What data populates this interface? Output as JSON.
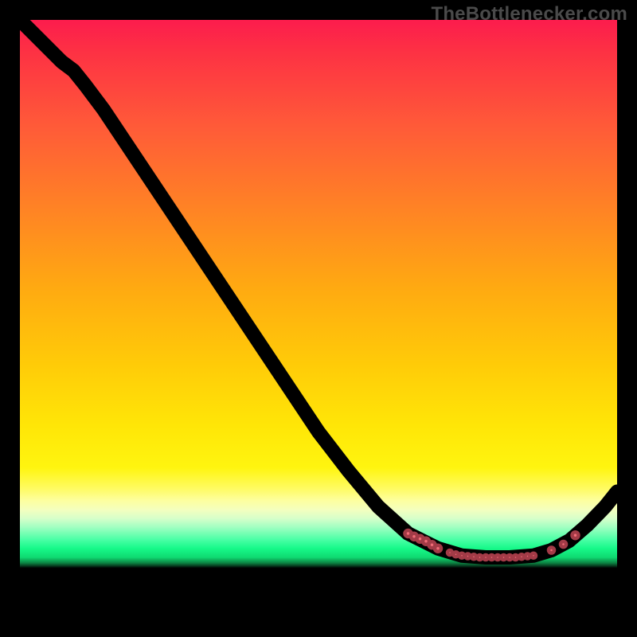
{
  "watermark": {
    "text": "TheBottlenecker.com"
  },
  "colors": {
    "background": "#000000",
    "gradient_top": "#fc1c4d",
    "gradient_mid": "#ffe607",
    "gradient_green": "#17f989",
    "curve": "#000000",
    "marker_fill": "#f26d78",
    "marker_stroke": "#a33b47"
  },
  "chart_data": {
    "type": "line",
    "title": "",
    "xlabel": "",
    "ylabel": "",
    "xlim": [
      0,
      100
    ],
    "ylim": [
      0,
      100
    ],
    "grid": false,
    "legend": false,
    "curve": [
      {
        "x": 0,
        "y": 100
      },
      {
        "x": 2,
        "y": 98
      },
      {
        "x": 5,
        "y": 95
      },
      {
        "x": 7,
        "y": 93
      },
      {
        "x": 9,
        "y": 91.5
      },
      {
        "x": 11,
        "y": 89
      },
      {
        "x": 14,
        "y": 85
      },
      {
        "x": 16,
        "y": 82
      },
      {
        "x": 20,
        "y": 76
      },
      {
        "x": 25,
        "y": 68.5
      },
      {
        "x": 30,
        "y": 61
      },
      {
        "x": 35,
        "y": 53.5
      },
      {
        "x": 40,
        "y": 46
      },
      {
        "x": 45,
        "y": 38.5
      },
      {
        "x": 50,
        "y": 31
      },
      {
        "x": 55,
        "y": 24.5
      },
      {
        "x": 60,
        "y": 18.5
      },
      {
        "x": 65,
        "y": 14
      },
      {
        "x": 70,
        "y": 11.5
      },
      {
        "x": 74,
        "y": 10.3
      },
      {
        "x": 78,
        "y": 10.0
      },
      {
        "x": 82,
        "y": 10.0
      },
      {
        "x": 86,
        "y": 10.3
      },
      {
        "x": 89,
        "y": 11.2
      },
      {
        "x": 92,
        "y": 12.8
      },
      {
        "x": 95,
        "y": 15.4
      },
      {
        "x": 98,
        "y": 18.5
      },
      {
        "x": 100,
        "y": 21
      }
    ],
    "markers": [
      {
        "x": 65,
        "y": 14.0,
        "r": 4
      },
      {
        "x": 66,
        "y": 13.5,
        "r": 4
      },
      {
        "x": 67,
        "y": 13.1,
        "r": 4
      },
      {
        "x": 68,
        "y": 12.7,
        "r": 4
      },
      {
        "x": 69,
        "y": 12.1,
        "r": 4
      },
      {
        "x": 70,
        "y": 11.5,
        "r": 4
      },
      {
        "x": 72,
        "y": 10.8,
        "r": 3
      },
      {
        "x": 73,
        "y": 10.5,
        "r": 3
      },
      {
        "x": 74,
        "y": 10.3,
        "r": 3
      },
      {
        "x": 75,
        "y": 10.2,
        "r": 3
      },
      {
        "x": 76,
        "y": 10.1,
        "r": 3
      },
      {
        "x": 77,
        "y": 10.0,
        "r": 3
      },
      {
        "x": 78,
        "y": 10.0,
        "r": 3
      },
      {
        "x": 79,
        "y": 10.0,
        "r": 3
      },
      {
        "x": 80,
        "y": 10.0,
        "r": 3
      },
      {
        "x": 81,
        "y": 10.0,
        "r": 3
      },
      {
        "x": 82,
        "y": 10.0,
        "r": 3
      },
      {
        "x": 83,
        "y": 10.0,
        "r": 3
      },
      {
        "x": 84,
        "y": 10.1,
        "r": 3
      },
      {
        "x": 85,
        "y": 10.2,
        "r": 3
      },
      {
        "x": 86,
        "y": 10.3,
        "r": 3
      },
      {
        "x": 89,
        "y": 11.2,
        "r": 3.5
      },
      {
        "x": 91,
        "y": 12.2,
        "r": 3.5
      },
      {
        "x": 93,
        "y": 13.7,
        "r": 4
      }
    ]
  }
}
